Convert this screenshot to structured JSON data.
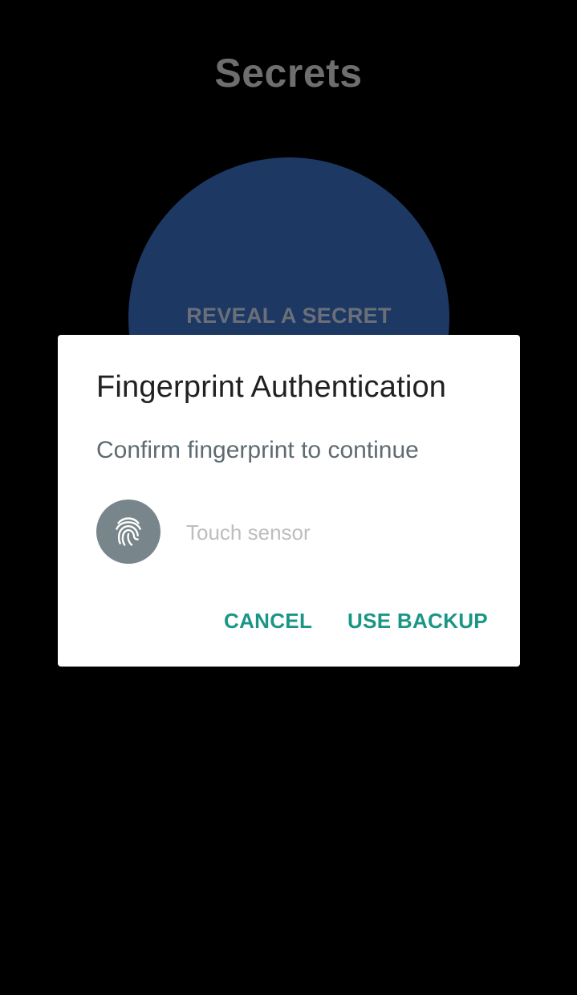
{
  "app": {
    "title": "Secrets"
  },
  "main": {
    "reveal_button_label": "REVEAL A SECRET"
  },
  "dialog": {
    "title": "Fingerprint Authentication",
    "message": "Confirm fingerprint to continue",
    "status_text": "Touch sensor",
    "icon": "fingerprint-icon",
    "buttons": {
      "cancel_label": "CANCEL",
      "backup_label": "USE BACKUP"
    }
  },
  "colors": {
    "background": "#000000",
    "circle": "#1e3864",
    "accent": "#1a9686",
    "icon_badge": "#78868b"
  }
}
